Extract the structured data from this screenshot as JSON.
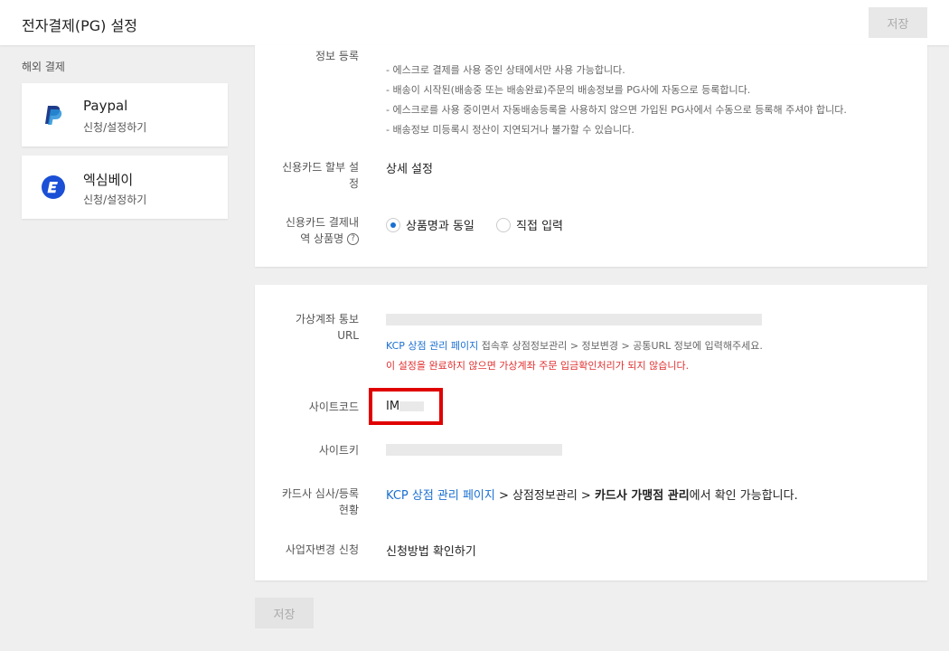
{
  "header": {
    "title": "전자결제(PG) 설정",
    "save_label": "저장"
  },
  "sidebar": {
    "section_label": "해외 결제",
    "items": [
      {
        "name": "Paypal",
        "sub": "신청/설정하기",
        "icon": "paypal-logo",
        "color": "#1f3b8a"
      },
      {
        "name": "엑심베이",
        "sub": "신청/설정하기",
        "icon": "eximbay-logo",
        "color": "#1a4fd6"
      }
    ]
  },
  "panel1": {
    "info_reg_label": "정보 등록",
    "notes": [
      "- 에스크로 결제를 사용 중인 상태에서만 사용 가능합니다.",
      "- 배송이 시작된(배송중 또는 배송완료)주문의 배송정보를 PG사에 자동으로 등록합니다.",
      "- 에스크로를 사용 중이면서 자동배송등록을 사용하지 않으면 가입된 PG사에서 수동으로 등록해 주셔야 합니다.",
      "- 배송정보 미등록시 정산이 지연되거나 불가할 수 있습니다."
    ],
    "installment_label_1": "신용카드 할부 설",
    "installment_label_2": "정",
    "installment_link": "상세 설정",
    "product_name_label_1": "신용카드 결제내",
    "product_name_label_2": "역 상품명",
    "help_icon": "?",
    "radio_options": [
      "상품명과 동일",
      "직접 입력"
    ],
    "radio_selected": "상품명과 동일"
  },
  "panel2": {
    "vaccount_label_1": "가상계좌 통보",
    "vaccount_label_2": "URL",
    "vaccount_note_link": "KCP 상점 관리 페이지",
    "vaccount_note_rest": " 접속후 상점정보관리 > 정보변경 > 공통URL 정보에 입력해주세요.",
    "vaccount_warning": "이 설정을 완료하지 않으면 가상계좌 주문 입금확인처리가 되지 않습니다.",
    "site_code_label": "사이트코드",
    "site_code_value": "IM",
    "site_key_label": "사이트키",
    "card_status_label_1": "카드사 심사/등록",
    "card_status_label_2": "현황",
    "card_status_link": "KCP 상점 관리 페이지",
    "card_status_mid": " > 상점정보관리 > ",
    "card_status_bold": "카드사 가맹점 관리",
    "card_status_end": "에서 확인 가능합니다.",
    "biz_change_label": "사업자변경 신청",
    "biz_change_link": "신청방법 확인하기"
  },
  "footer": {
    "save_label": "저장"
  },
  "colors": {
    "accent": "#1a6fd1",
    "warning": "#e03030",
    "highlight": "#e00000"
  }
}
